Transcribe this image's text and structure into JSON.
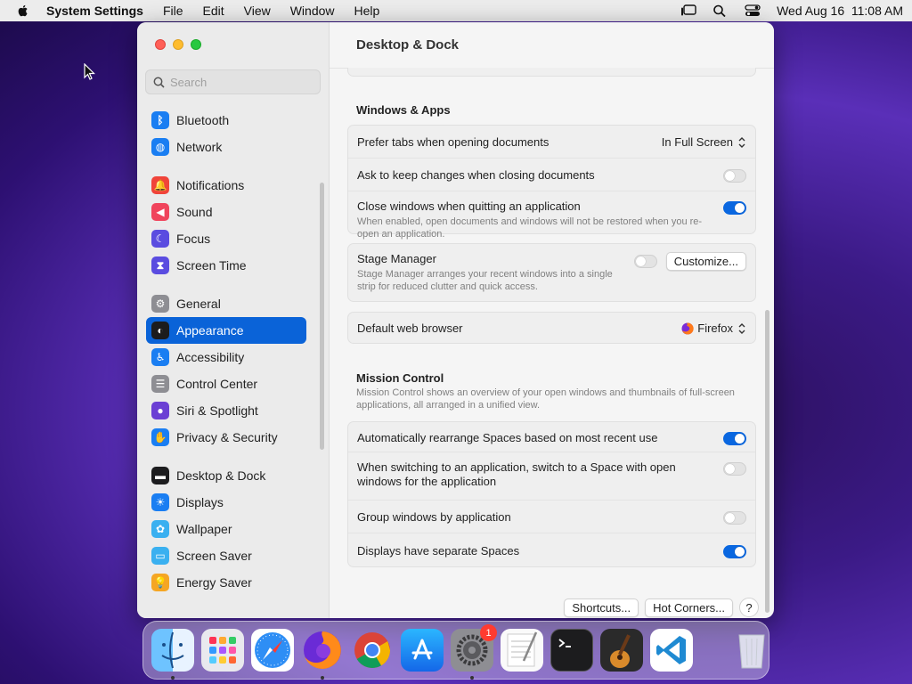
{
  "menubar": {
    "app_name": "System Settings",
    "menus": [
      "File",
      "Edit",
      "View",
      "Window",
      "Help"
    ],
    "clock": "Wed Aug 16  11:08 AM"
  },
  "window": {
    "title": "Desktop & Dock",
    "search_placeholder": "Search"
  },
  "sidebar": {
    "items": [
      {
        "label": "Bluetooth",
        "icon": "bluetooth-icon",
        "color": "#1a7ef2"
      },
      {
        "label": "Network",
        "icon": "globe-icon",
        "color": "#1a7ef2"
      },
      {
        "label": "Notifications",
        "icon": "bell-icon",
        "color": "#f0443a"
      },
      {
        "label": "Sound",
        "icon": "speaker-icon",
        "color": "#f0445c"
      },
      {
        "label": "Focus",
        "icon": "moon-icon",
        "color": "#5a4ce0"
      },
      {
        "label": "Screen Time",
        "icon": "hourglass-icon",
        "color": "#5a4ce0"
      },
      {
        "label": "General",
        "icon": "gear-icon",
        "color": "#8e8e93"
      },
      {
        "label": "Appearance",
        "icon": "appearance-icon",
        "color": "#1c1c1e",
        "selected": true
      },
      {
        "label": "Accessibility",
        "icon": "accessibility-icon",
        "color": "#1a7ef2"
      },
      {
        "label": "Control Center",
        "icon": "control-center-icon",
        "color": "#8e8e93"
      },
      {
        "label": "Siri & Spotlight",
        "icon": "siri-icon",
        "color": "#6b3fd4"
      },
      {
        "label": "Privacy & Security",
        "icon": "hand-icon",
        "color": "#1a7ef2"
      },
      {
        "label": "Desktop & Dock",
        "icon": "dock-icon",
        "color": "#1c1c1e"
      },
      {
        "label": "Displays",
        "icon": "sun-icon",
        "color": "#1a7ef2"
      },
      {
        "label": "Wallpaper",
        "icon": "flower-icon",
        "color": "#3ab0f0"
      },
      {
        "label": "Screen Saver",
        "icon": "screen-saver-icon",
        "color": "#3ab0f0"
      },
      {
        "label": "Energy Saver",
        "icon": "bulb-icon",
        "color": "#f5a623"
      }
    ]
  },
  "sections": {
    "windows_apps_title": "Windows & Apps",
    "prefer_tabs_label": "Prefer tabs when opening documents",
    "prefer_tabs_value": "In Full Screen",
    "ask_keep_label": "Ask to keep changes when closing documents",
    "close_windows_label": "Close windows when quitting an application",
    "close_windows_desc": "When enabled, open documents and windows will not be restored when you re-open an application.",
    "stage_manager_label": "Stage Manager",
    "stage_manager_desc": "Stage Manager arranges your recent windows into a single strip for reduced clutter and quick access.",
    "customize_label": "Customize...",
    "default_browser_label": "Default web browser",
    "default_browser_value": "Firefox",
    "mission_control_title": "Mission Control",
    "mission_control_desc": "Mission Control shows an overview of your open windows and thumbnails of full-screen applications, all arranged in a unified view.",
    "auto_rearrange_label": "Automatically rearrange Spaces based on most recent use",
    "switch_space_label": "When switching to an application, switch to a Space with open windows for the application",
    "group_windows_label": "Group windows by application",
    "separate_spaces_label": "Displays have separate Spaces",
    "shortcuts_label": "Shortcuts...",
    "hot_corners_label": "Hot Corners...",
    "help_label": "?"
  },
  "toggles": {
    "ask_keep": false,
    "close_windows": true,
    "stage_manager": false,
    "auto_rearrange": true,
    "switch_space": false,
    "group_windows": false,
    "separate_spaces": true
  },
  "dock": {
    "apps": [
      "Finder",
      "Launchpad",
      "Safari",
      "Firefox",
      "Google Chrome",
      "App Store",
      "System Settings",
      "TextEdit",
      "Terminal",
      "GarageBand",
      "Visual Studio Code",
      "Trash"
    ],
    "system_settings_badge": "1"
  }
}
